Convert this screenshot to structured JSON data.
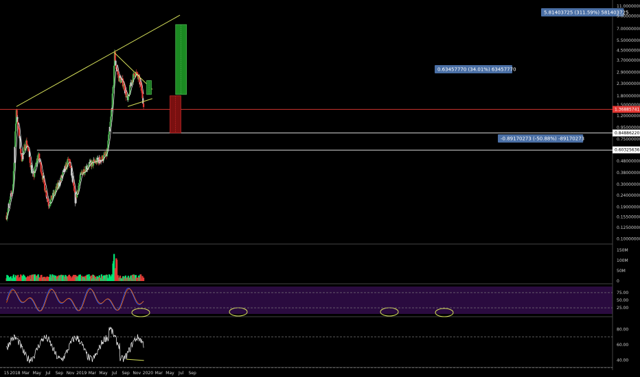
{
  "chart_data": [
    {
      "type": "candlestick",
      "panel": "price",
      "title": "",
      "y_scale": "log",
      "x_range": [
        "2017-11",
        "2020-10"
      ],
      "y_range": [
        0.095,
        11.5
      ],
      "y_tick_labels": [
        "11.00000000",
        "9.00000000",
        "7.00000000",
        "5.50000000",
        "4.50000000",
        "3.70000000",
        "2.90000000",
        "2.30000000",
        "1.80000000",
        "1.50000000",
        "1.20000000",
        "0.95000000",
        "0.75000000",
        "0.60000000",
        "0.48000000",
        "0.38000000",
        "0.30000000",
        "0.24000000",
        "0.19000000",
        "0.15500000",
        "0.12500000",
        "0.10000000"
      ],
      "x_tick_labels": [
        "15",
        "2018",
        "Mar",
        "May",
        "Jul",
        "Sep",
        "Nov",
        "2019",
        "Mar",
        "May",
        "Jul",
        "Sep",
        "Nov",
        "2020",
        "Mar",
        "May",
        "Jul",
        "Sep"
      ],
      "key_points": [
        {
          "date": "2017-11-15",
          "price": 0.16
        },
        {
          "date": "2017-12-20",
          "price": 0.28
        },
        {
          "date": "2018-01-08",
          "price": 1.35
        },
        {
          "date": "2018-02-05",
          "price": 0.5
        },
        {
          "date": "2018-03-05",
          "price": 0.72
        },
        {
          "date": "2018-04-10",
          "price": 0.34
        },
        {
          "date": "2018-05-08",
          "price": 0.55
        },
        {
          "date": "2018-06-10",
          "price": 0.3
        },
        {
          "date": "2018-07-05",
          "price": 0.2
        },
        {
          "date": "2018-08-05",
          "price": 0.25
        },
        {
          "date": "2018-09-05",
          "price": 0.32
        },
        {
          "date": "2018-10-25",
          "price": 0.5
        },
        {
          "date": "2018-11-28",
          "price": 0.22
        },
        {
          "date": "2019-01-01",
          "price": 0.38
        },
        {
          "date": "2019-02-05",
          "price": 0.44
        },
        {
          "date": "2019-04-20",
          "price": 0.5
        },
        {
          "date": "2019-05-20",
          "price": 0.55
        },
        {
          "date": "2019-06-10",
          "price": 1.1
        },
        {
          "date": "2019-06-26",
          "price": 2.3
        },
        {
          "date": "2019-07-01",
          "price": 4.3
        },
        {
          "date": "2019-07-10",
          "price": 3.2
        },
        {
          "date": "2019-07-25",
          "price": 2.6
        },
        {
          "date": "2019-08-20",
          "price": 2.3
        },
        {
          "date": "2019-09-12",
          "price": 1.6
        },
        {
          "date": "2019-10-01",
          "price": 2.4
        },
        {
          "date": "2019-10-25",
          "price": 2.9
        },
        {
          "date": "2019-11-20",
          "price": 2.3
        },
        {
          "date": "2019-12-08",
          "price": 1.55
        }
      ],
      "horizontal_lines": [
        {
          "label": "1.36885741",
          "color": "#e53935"
        },
        {
          "label": "0.84886220",
          "color": "#ffffff"
        },
        {
          "label": "0.60325636",
          "color": "#ffffff"
        }
      ],
      "measure_boxes": [
        {
          "label": "0.63457770 (34.01%) 63457770"
        },
        {
          "label": "-0.89170273 (-50.88%) -89170273"
        },
        {
          "label": "5.81403725 (311.59%) 581403725"
        }
      ]
    },
    {
      "type": "bar",
      "panel": "volume",
      "y_tick_labels": [
        "150M",
        "100M",
        "50M",
        "0"
      ],
      "y_range": [
        0,
        160
      ]
    },
    {
      "type": "line",
      "panel": "stochastic",
      "series": [
        {
          "color": "#2962ff"
        },
        {
          "color": "#ff6d00"
        }
      ],
      "y_tick_labels": [
        "75.00",
        "50.00",
        "25.00"
      ],
      "y_range": [
        5,
        95
      ]
    },
    {
      "type": "line",
      "panel": "oscillator",
      "series": [
        {
          "color": "#ffffff"
        }
      ],
      "y_tick_labels": [
        "80.00",
        "60.00",
        "40.00"
      ],
      "y_range": [
        34,
        93
      ]
    }
  ],
  "colors": {
    "bull": "#4caf50",
    "bull_highlight": "#00e676",
    "bear": "#e53935",
    "neutral": "#cfcfcf",
    "purple_bg": "#2a0b3f",
    "trendline": "#d6e05a",
    "ma": "#ffffff"
  }
}
